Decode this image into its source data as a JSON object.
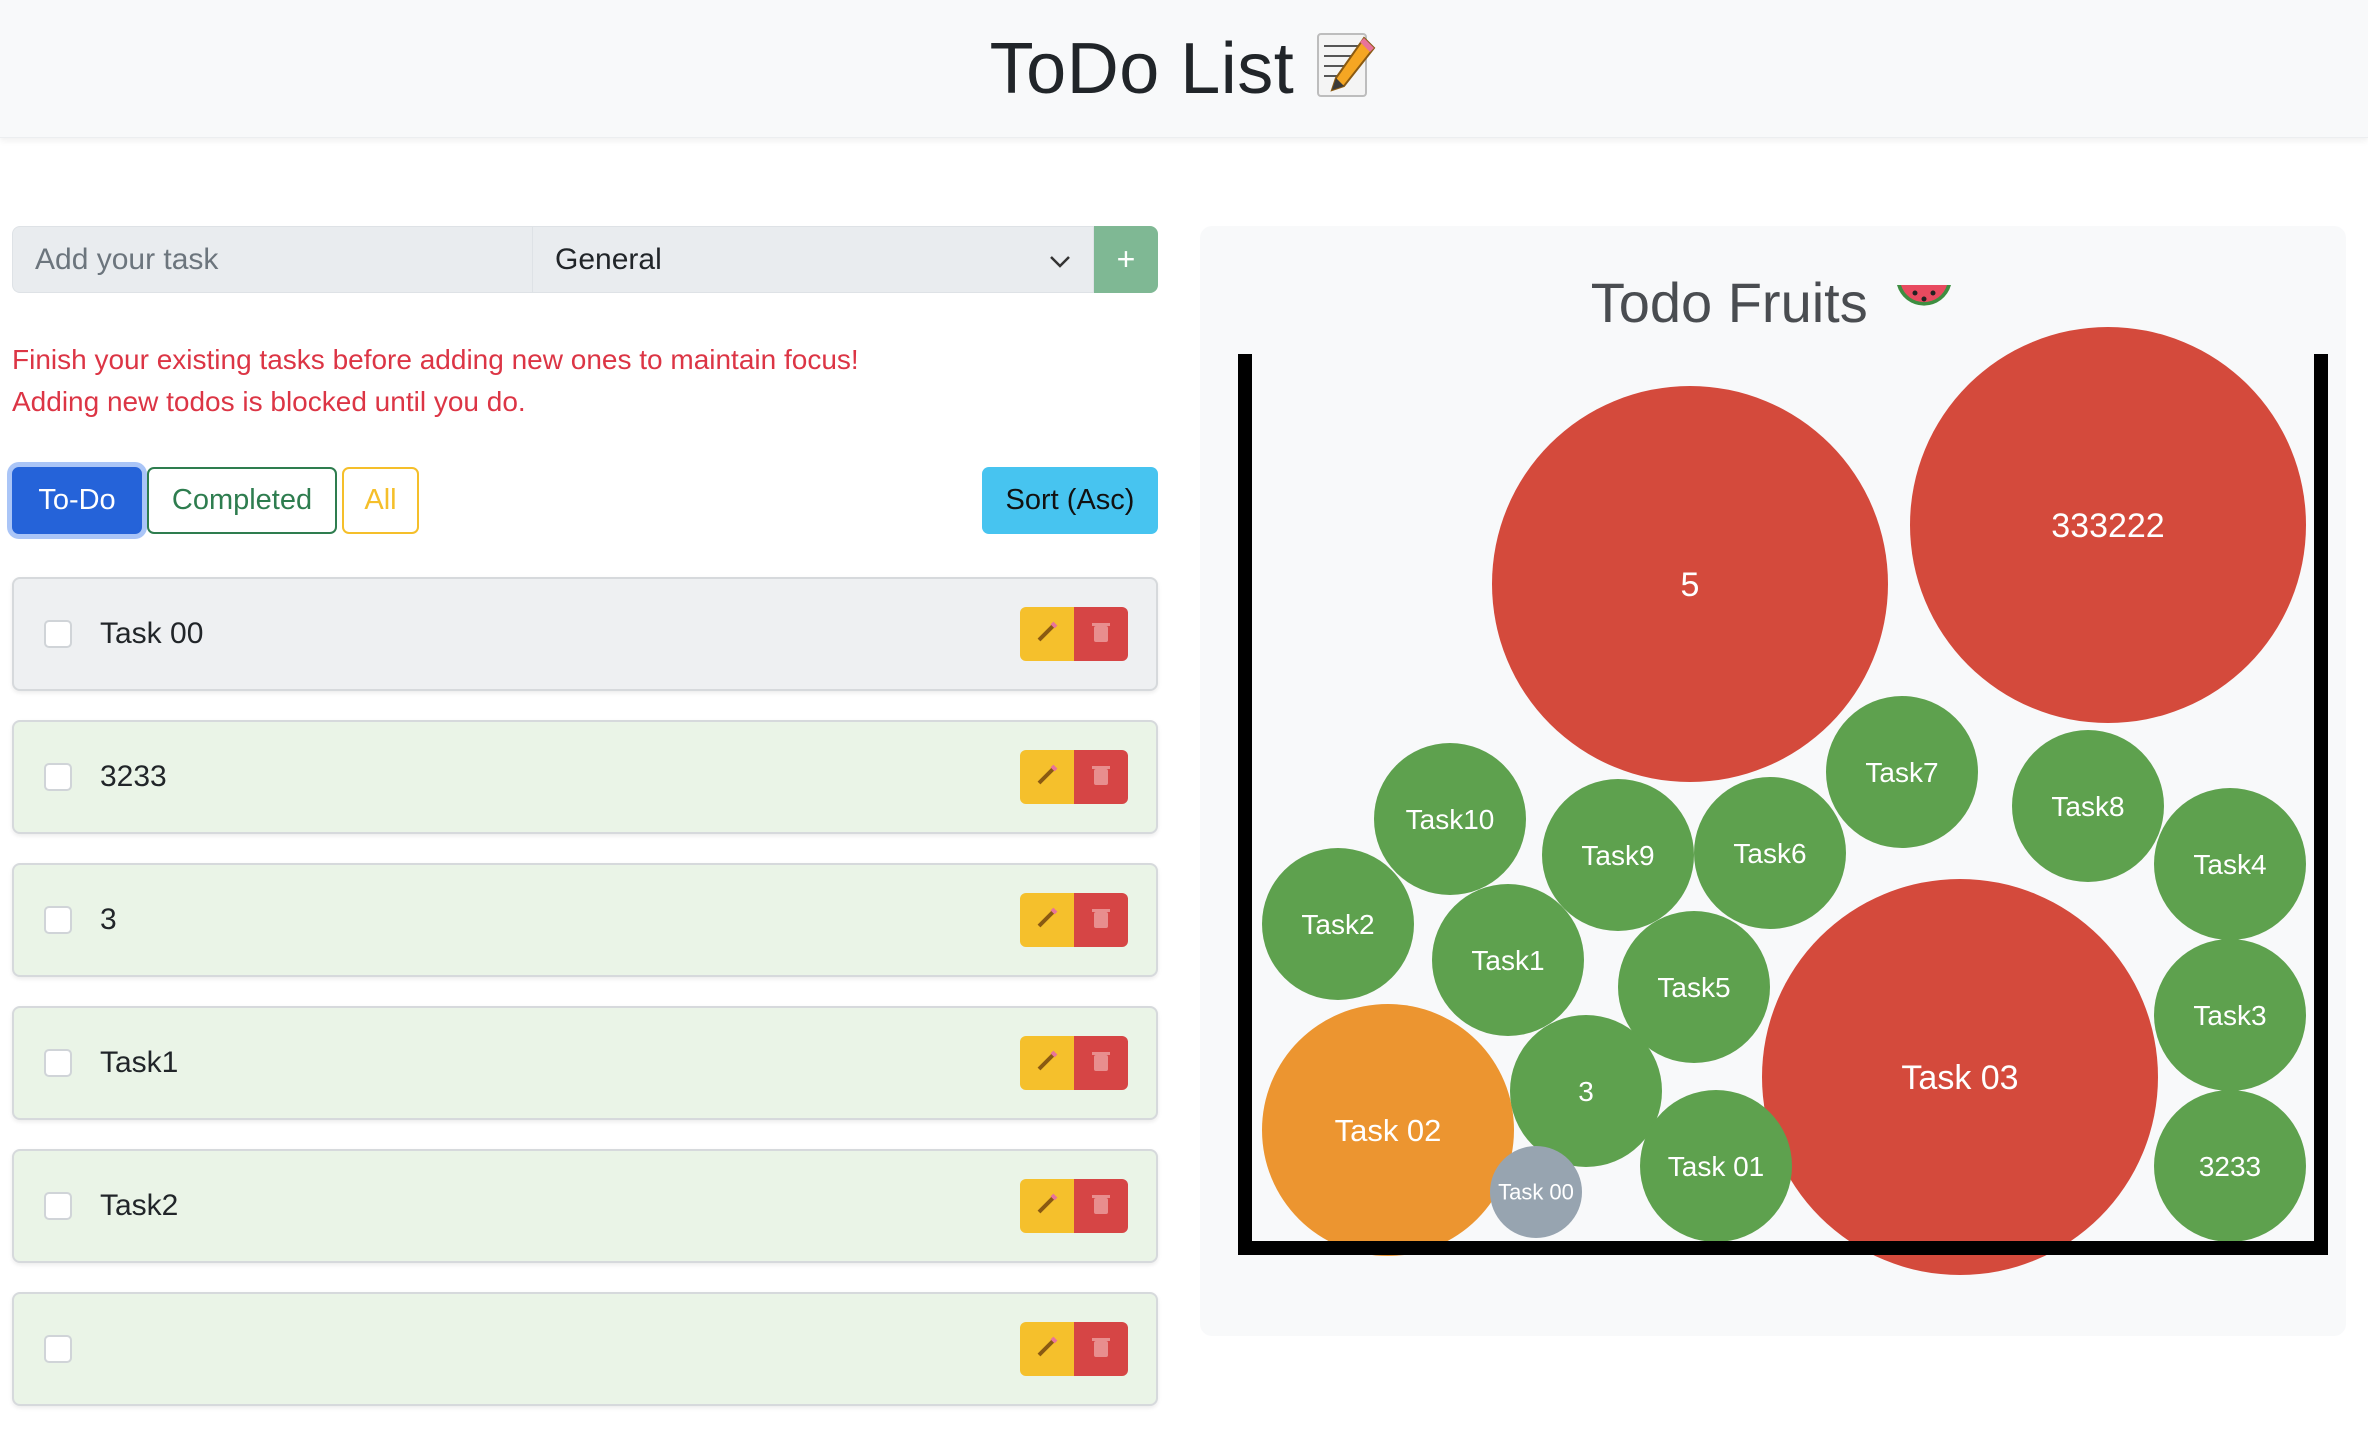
{
  "header": {
    "title": "ToDo List",
    "title_icon": "memo-pencil-icon"
  },
  "add_form": {
    "placeholder": "Add your task",
    "category": "General",
    "add_label": "+"
  },
  "warning": {
    "line1": "Finish your existing tasks before adding new ones to maintain focus!",
    "line2": "Adding new todos is blocked until you do."
  },
  "filters": {
    "todo": "To-Do",
    "completed": "Completed",
    "all": "All",
    "sort": "Sort (Asc)",
    "active": "To-Do"
  },
  "tasks": [
    {
      "name": "Task 00"
    },
    {
      "name": "3233"
    },
    {
      "name": "3"
    },
    {
      "name": "Task1"
    },
    {
      "name": "Task2"
    },
    {
      "name": ""
    }
  ],
  "fruits_panel": {
    "title": "Todo Fruits",
    "title_icon": "watermelon-icon",
    "colors": {
      "red": "#d44a3c",
      "green": "#5ea14e",
      "orange": "#ec9530",
      "gray": "#97a4b0",
      "wall": "#000000"
    },
    "fruits": [
      {
        "label": "5",
        "color": "red"
      },
      {
        "label": "333222",
        "color": "red"
      },
      {
        "label": "Task7",
        "color": "green"
      },
      {
        "label": "Task8",
        "color": "green"
      },
      {
        "label": "Task10",
        "color": "green"
      },
      {
        "label": "Task9",
        "color": "green"
      },
      {
        "label": "Task6",
        "color": "green"
      },
      {
        "label": "Task4",
        "color": "green"
      },
      {
        "label": "Task2",
        "color": "green"
      },
      {
        "label": "Task1",
        "color": "green"
      },
      {
        "label": "Task5",
        "color": "green"
      },
      {
        "label": "Task 03",
        "color": "red"
      },
      {
        "label": "Task3",
        "color": "green"
      },
      {
        "label": "Task 02",
        "color": "orange"
      },
      {
        "label": "3",
        "color": "green"
      },
      {
        "label": "Task 01",
        "color": "green"
      },
      {
        "label": "3233",
        "color": "green"
      },
      {
        "label": "Task 00",
        "color": "gray"
      }
    ]
  }
}
